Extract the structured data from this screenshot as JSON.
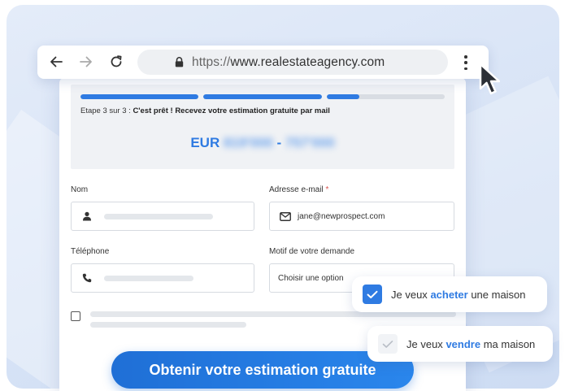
{
  "browser": {
    "url_protocol": "https://",
    "url_host": "www.realestateagency.com"
  },
  "form": {
    "progress": {
      "total_steps": 3,
      "current_step": 3,
      "segment_fill": [
        1.0,
        1.0,
        0.28
      ]
    },
    "step_prefix": "Etape 3 sur 3 :",
    "step_title": "C'est prêt ! Recevez votre estimation gratuite par mail",
    "estimate": {
      "currency": "EUR",
      "low": "819'000",
      "separator": "-",
      "high": "757'000"
    },
    "name_label": "Nom",
    "email_label": "Adresse e-mail",
    "email_required_mark": "*",
    "email_value": "jane@newprospect.com",
    "phone_label": "Téléphone",
    "reason_label": "Motif de votre demande",
    "reason_selected": "Choisir une option",
    "cta_label": "Obtenir votre estimation gratuite"
  },
  "options": [
    {
      "prefix": "Je veux",
      "keyword": "acheter",
      "suffix": "une maison",
      "checked": true
    },
    {
      "prefix": "Je veux",
      "keyword": "vendre",
      "suffix": "ma maison",
      "checked": false
    }
  ],
  "colors": {
    "accent": "#2f7be2",
    "cta_start": "#1f6fd6",
    "cta_end": "#2a86ec",
    "required": "#d9534f"
  },
  "icons": [
    "back-arrow-icon",
    "forward-arrow-icon",
    "reload-icon",
    "lock-icon",
    "more-vertical-icon",
    "user-icon",
    "mail-icon",
    "phone-icon",
    "checkmark-icon",
    "mouse-cursor-icon"
  ]
}
